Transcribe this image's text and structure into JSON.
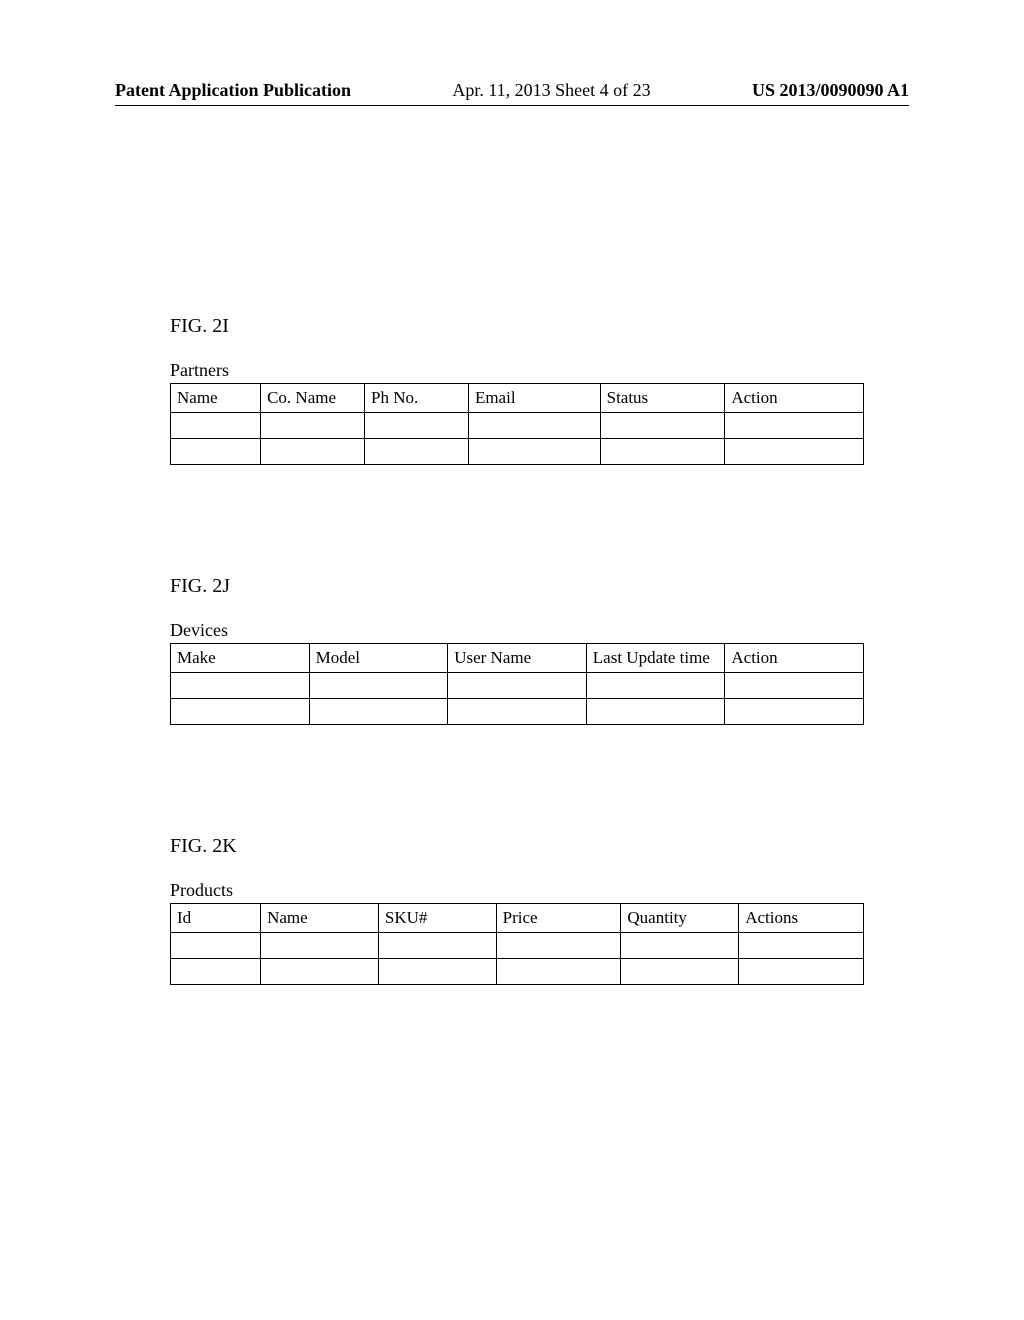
{
  "header": {
    "publication_label": "Patent Application Publication",
    "date_sheet": "Apr. 11, 2013  Sheet 4 of 23",
    "patent_number": "US 2013/0090090 A1"
  },
  "figures": [
    {
      "label": "FIG. 2I",
      "table_title": "Partners",
      "headers": [
        "Name",
        "Co. Name",
        "Ph No.",
        "Email",
        "Status",
        "Action"
      ],
      "rows": [
        [
          "",
          "",
          "",
          "",
          "",
          ""
        ],
        [
          "",
          "",
          "",
          "",
          "",
          ""
        ]
      ],
      "table_class": "partners-table"
    },
    {
      "label": "FIG. 2J",
      "table_title": "Devices",
      "headers": [
        "Make",
        "Model",
        "User Name",
        "Last Update time",
        "Action"
      ],
      "rows": [
        [
          "",
          "",
          "",
          "",
          ""
        ],
        [
          "",
          "",
          "",
          "",
          ""
        ]
      ],
      "table_class": "devices-table"
    },
    {
      "label": "FIG. 2K",
      "table_title": "Products",
      "headers": [
        "Id",
        "Name",
        "SKU#",
        "Price",
        "Quantity",
        "Actions"
      ],
      "rows": [
        [
          "",
          "",
          "",
          "",
          "",
          ""
        ],
        [
          "",
          "",
          "",
          "",
          "",
          ""
        ]
      ],
      "table_class": "products-table"
    }
  ]
}
